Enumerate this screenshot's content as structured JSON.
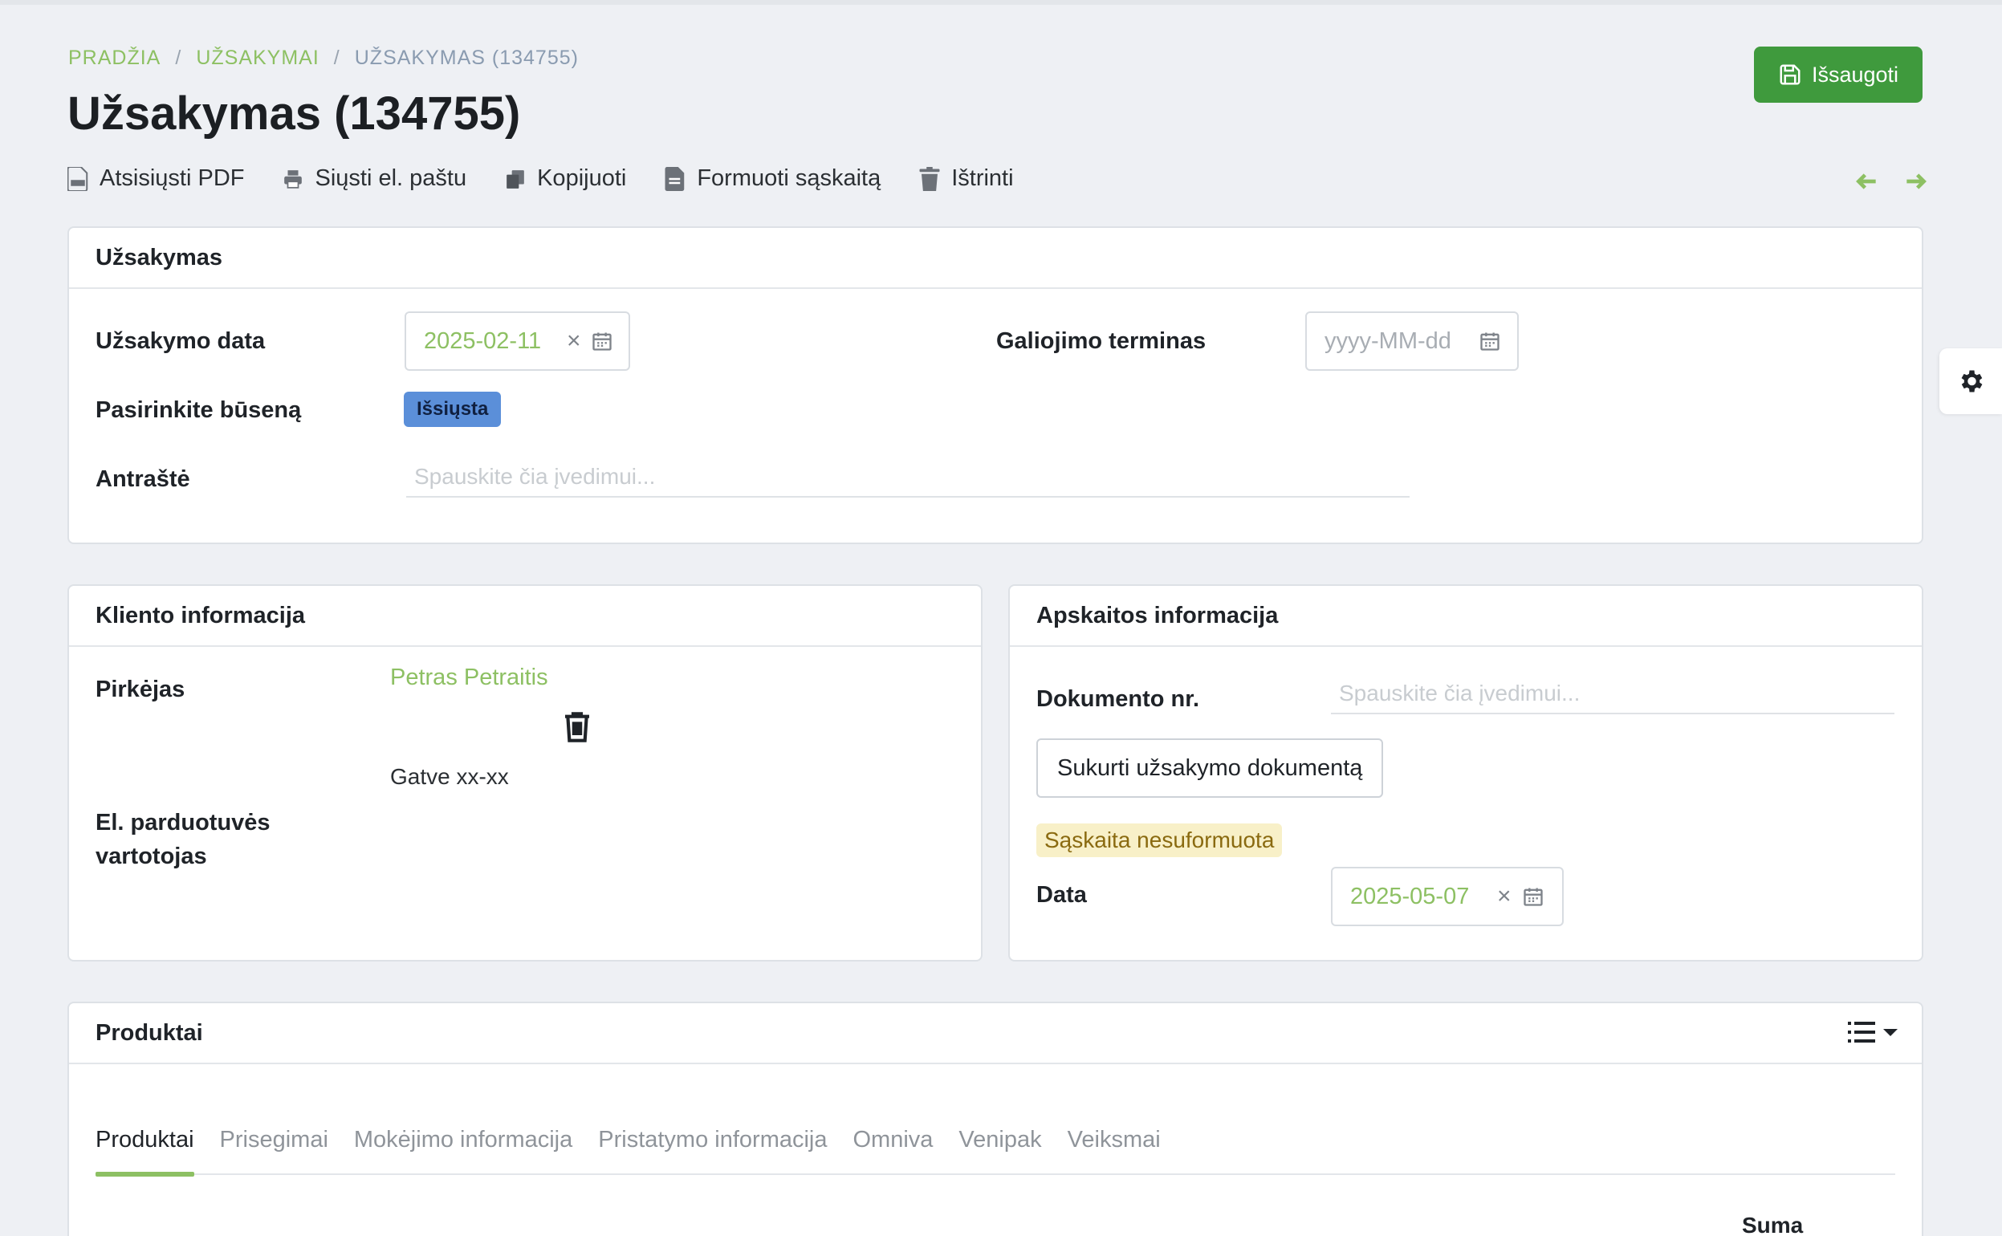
{
  "breadcrumb": {
    "home": "PRADŽIA",
    "orders": "UŽSAKYMAI",
    "current": "UŽSAKYMAS (134755)",
    "sep": "/"
  },
  "title": "Užsakymas (134755)",
  "save_label": "Išsaugoti",
  "toolbar": {
    "download_pdf": "Atsisiųsti PDF",
    "send_email": "Siųsti el. paštu",
    "copy": "Kopijuoti",
    "make_invoice": "Formuoti sąskaitą",
    "delete": "Ištrinti"
  },
  "order_card": {
    "header": "Užsakymas",
    "order_date_label": "Užsakymo data",
    "order_date_value": "2025-02-11",
    "validity_label": "Galiojimo terminas",
    "validity_placeholder": "yyyy-MM-dd",
    "status_label": "Pasirinkite būseną",
    "status_value": "Išsiųsta",
    "heading_label": "Antraštė",
    "heading_placeholder": "Spauskite čia įvedimui..."
  },
  "client_card": {
    "header": "Kliento informacija",
    "buyer_label": "Pirkėjas",
    "buyer_name": "Petras Petraitis",
    "buyer_address": "Gatve xx-xx",
    "eshop_user_label_1": "El. parduotuvės",
    "eshop_user_label_2": "vartotojas"
  },
  "accounting_card": {
    "header": "Apskaitos informacija",
    "doc_no_label": "Dokumento nr.",
    "doc_no_placeholder": "Spauskite čia įvedimui...",
    "create_doc_button": "Sukurti užsakymo dokumentą",
    "invoice_status": "Sąskaita nesuformuota",
    "date_label": "Data",
    "date_value": "2025-05-07"
  },
  "products_card": {
    "header": "Produktai",
    "tabs": [
      "Produktai",
      "Prisegimai",
      "Mokėjimo informacija",
      "Pristatymo informacija",
      "Omniva",
      "Venipak",
      "Veiksmai"
    ],
    "column_sum": "Suma"
  },
  "colors": {
    "accent_green": "#8dc063",
    "save_green": "#3f9a3d",
    "status_blue": "#5b8fd9",
    "invoice_badge_bg": "#f8f0c8"
  }
}
